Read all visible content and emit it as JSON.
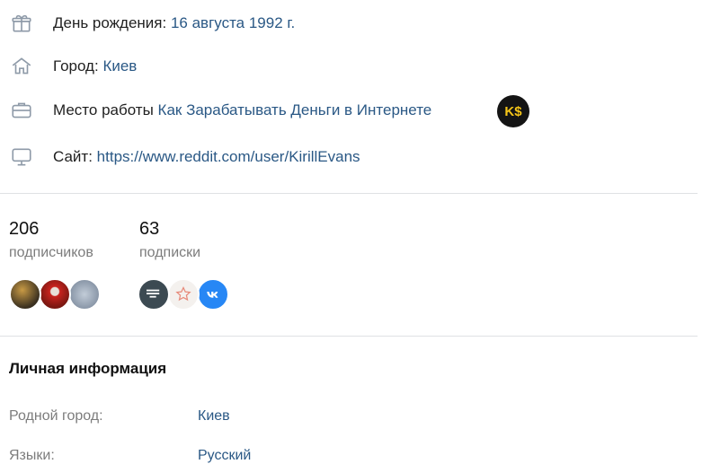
{
  "profile_info": {
    "birthday_label": "День рождения:",
    "birthday_value": "16 августа 1992 г.",
    "city_label": "Город:",
    "city_value": "Киев",
    "work_label": "Место работы",
    "work_value": "Как Зарабатывать Деньги в Интернете",
    "work_badge_text": "K$",
    "site_label": "Сайт:",
    "site_value": "https://www.reddit.com/user/KirillEvans"
  },
  "counters": {
    "followers_count": "206",
    "followers_label": "подписчиков",
    "following_count": "63",
    "following_label": "подписки"
  },
  "personal": {
    "title": "Личная информация",
    "hometown_label": "Родной город:",
    "hometown_value": "Киев",
    "languages_label": "Языки:",
    "languages_value": "Русский"
  },
  "colors": {
    "link": "#2a5885",
    "muted": "#7c7c7c",
    "divider": "#dfe1e4",
    "vk_blue": "#2787f5",
    "badge_yellow": "#f5c518"
  }
}
